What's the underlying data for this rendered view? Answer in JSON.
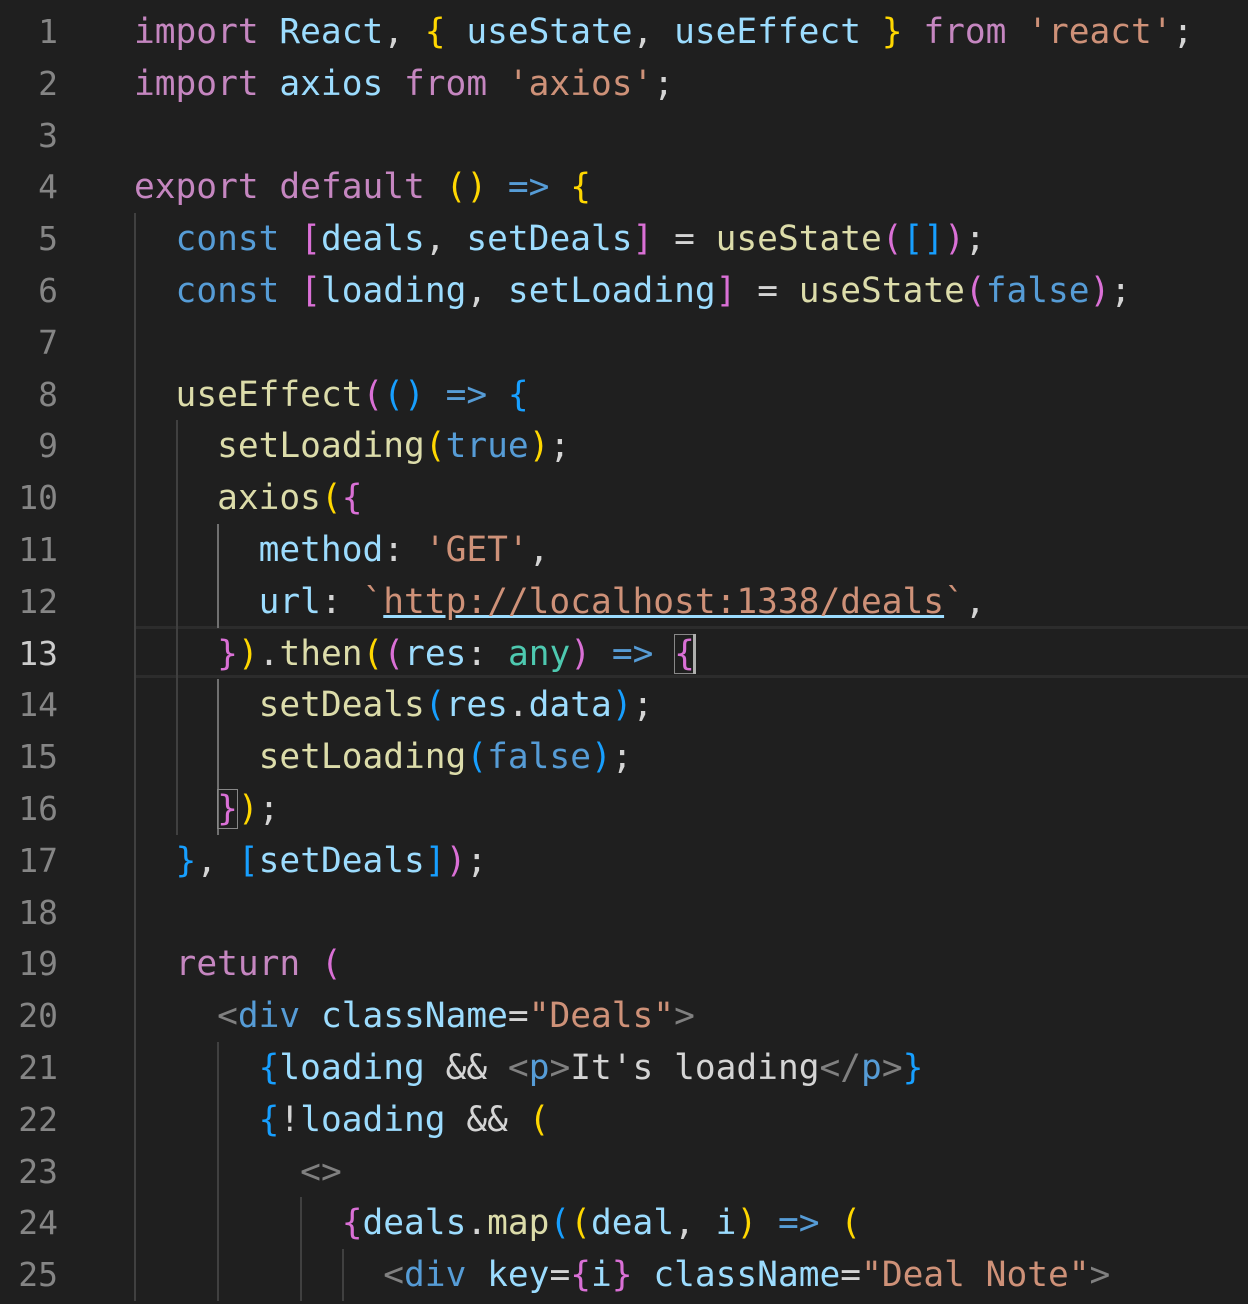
{
  "editor": {
    "active_line": 13,
    "colors": {
      "background": "#1f1f1f",
      "keyword_control": "#c586c0",
      "keyword": "#569cd6",
      "variable": "#9cdcfe",
      "function": "#dcdcaa",
      "string": "#ce9178",
      "type": "#4ec9b0",
      "bracket_level1": "#ffd700",
      "bracket_level2": "#da70d6",
      "bracket_level3": "#179fff"
    },
    "line_numbers": [
      "1",
      "2",
      "3",
      "4",
      "5",
      "6",
      "7",
      "8",
      "9",
      "10",
      "11",
      "12",
      "13",
      "14",
      "15",
      "16",
      "17",
      "18",
      "19",
      "20",
      "21",
      "22",
      "23",
      "24",
      "25"
    ],
    "lines": [
      [
        [
          "kw-import",
          "import"
        ],
        [
          "var",
          " React"
        ],
        [
          "punc",
          ", "
        ],
        [
          "b1",
          "{"
        ],
        [
          "var",
          " useState"
        ],
        [
          "punc",
          ", "
        ],
        [
          "var",
          "useEffect "
        ],
        [
          "b1",
          "}"
        ],
        [
          "kw-import",
          " from"
        ],
        [
          "str",
          " 'react'"
        ],
        [
          "punc",
          ";"
        ]
      ],
      [
        [
          "kw-import",
          "import"
        ],
        [
          "var",
          " axios"
        ],
        [
          "kw-import",
          " from"
        ],
        [
          "str",
          " 'axios'"
        ],
        [
          "punc",
          ";"
        ]
      ],
      [],
      [
        [
          "kw-import",
          "export"
        ],
        [
          "kw-import",
          " default"
        ],
        [
          "punc",
          " "
        ],
        [
          "b1",
          "()"
        ],
        [
          "kw",
          " =>"
        ],
        [
          "punc",
          " "
        ],
        [
          "b1",
          "{"
        ]
      ],
      [
        [
          "punc",
          "  "
        ],
        [
          "kw",
          "const"
        ],
        [
          "punc",
          " "
        ],
        [
          "b2",
          "["
        ],
        [
          "var",
          "deals"
        ],
        [
          "punc",
          ", "
        ],
        [
          "var",
          "setDeals"
        ],
        [
          "b2",
          "]"
        ],
        [
          "punc",
          " = "
        ],
        [
          "fn",
          "useState"
        ],
        [
          "b2",
          "("
        ],
        [
          "b3",
          "[]"
        ],
        [
          "b2",
          ")"
        ],
        [
          "punc",
          ";"
        ]
      ],
      [
        [
          "punc",
          "  "
        ],
        [
          "kw",
          "const"
        ],
        [
          "punc",
          " "
        ],
        [
          "b2",
          "["
        ],
        [
          "var",
          "loading"
        ],
        [
          "punc",
          ", "
        ],
        [
          "var",
          "setLoading"
        ],
        [
          "b2",
          "]"
        ],
        [
          "punc",
          " = "
        ],
        [
          "fn",
          "useState"
        ],
        [
          "b2",
          "("
        ],
        [
          "kw",
          "false"
        ],
        [
          "b2",
          ")"
        ],
        [
          "punc",
          ";"
        ]
      ],
      [],
      [
        [
          "punc",
          "  "
        ],
        [
          "fn",
          "useEffect"
        ],
        [
          "b2",
          "("
        ],
        [
          "b3",
          "()"
        ],
        [
          "kw",
          " =>"
        ],
        [
          "punc",
          " "
        ],
        [
          "b3",
          "{"
        ]
      ],
      [
        [
          "punc",
          "    "
        ],
        [
          "fn",
          "setLoading"
        ],
        [
          "b1",
          "("
        ],
        [
          "kw",
          "true"
        ],
        [
          "b1",
          ")"
        ],
        [
          "punc",
          ";"
        ]
      ],
      [
        [
          "punc",
          "    "
        ],
        [
          "fn",
          "axios"
        ],
        [
          "b1",
          "("
        ],
        [
          "b2",
          "{"
        ]
      ],
      [
        [
          "punc",
          "      "
        ],
        [
          "var",
          "method"
        ],
        [
          "punc",
          ": "
        ],
        [
          "str",
          "'GET'"
        ],
        [
          "punc",
          ","
        ]
      ],
      [
        [
          "punc",
          "      "
        ],
        [
          "var",
          "url"
        ],
        [
          "punc",
          ": "
        ],
        [
          "str",
          "`"
        ],
        [
          "str link",
          "http://localhost:1338/deals"
        ],
        [
          "str",
          "`"
        ],
        [
          "punc",
          ","
        ]
      ],
      [
        [
          "punc",
          "    "
        ],
        [
          "b2",
          "}"
        ],
        [
          "b1",
          ")"
        ],
        [
          "punc",
          "."
        ],
        [
          "fn",
          "then"
        ],
        [
          "b1",
          "("
        ],
        [
          "b2",
          "("
        ],
        [
          "var",
          "res"
        ],
        [
          "punc",
          ": "
        ],
        [
          "type",
          "any"
        ],
        [
          "b2",
          ")"
        ],
        [
          "kw",
          " =>"
        ],
        [
          "punc",
          " "
        ],
        [
          "b2",
          "{"
        ]
      ],
      [
        [
          "punc",
          "      "
        ],
        [
          "fn",
          "setDeals"
        ],
        [
          "b3",
          "("
        ],
        [
          "var",
          "res"
        ],
        [
          "punc",
          "."
        ],
        [
          "var",
          "data"
        ],
        [
          "b3",
          ")"
        ],
        [
          "punc",
          ";"
        ]
      ],
      [
        [
          "punc",
          "      "
        ],
        [
          "fn",
          "setLoading"
        ],
        [
          "b3",
          "("
        ],
        [
          "kw",
          "false"
        ],
        [
          "b3",
          ")"
        ],
        [
          "punc",
          ";"
        ]
      ],
      [
        [
          "punc",
          "    "
        ],
        [
          "b2",
          "}"
        ],
        [
          "b1",
          ")"
        ],
        [
          "punc",
          ";"
        ]
      ],
      [
        [
          "punc",
          "  "
        ],
        [
          "b3",
          "}"
        ],
        [
          "punc",
          ", "
        ],
        [
          "b3",
          "["
        ],
        [
          "var",
          "setDeals"
        ],
        [
          "b3",
          "]"
        ],
        [
          "b2",
          ")"
        ],
        [
          "punc",
          ";"
        ]
      ],
      [],
      [
        [
          "punc",
          "  "
        ],
        [
          "kw-import",
          "return"
        ],
        [
          "punc",
          " "
        ],
        [
          "b2",
          "("
        ]
      ],
      [
        [
          "punc",
          "    "
        ],
        [
          "tag",
          "<"
        ],
        [
          "tagname",
          "div"
        ],
        [
          "attr",
          " className"
        ],
        [
          "punc",
          "="
        ],
        [
          "str",
          "\"Deals\""
        ],
        [
          "tag",
          ">"
        ]
      ],
      [
        [
          "punc",
          "      "
        ],
        [
          "b3",
          "{"
        ],
        [
          "var",
          "loading"
        ],
        [
          "punc",
          " && "
        ],
        [
          "tag",
          "<"
        ],
        [
          "tagname",
          "p"
        ],
        [
          "tag",
          ">"
        ],
        [
          "punc",
          "It's loading"
        ],
        [
          "tag",
          "</"
        ],
        [
          "tagname",
          "p"
        ],
        [
          "tag",
          ">"
        ],
        [
          "b3",
          "}"
        ]
      ],
      [
        [
          "punc",
          "      "
        ],
        [
          "b3",
          "{"
        ],
        [
          "punc",
          "!"
        ],
        [
          "var",
          "loading"
        ],
        [
          "punc",
          " && "
        ],
        [
          "b1",
          "("
        ]
      ],
      [
        [
          "punc",
          "        "
        ],
        [
          "tag",
          "<>"
        ]
      ],
      [
        [
          "punc",
          "          "
        ],
        [
          "b2",
          "{"
        ],
        [
          "var",
          "deals"
        ],
        [
          "punc",
          "."
        ],
        [
          "fn",
          "map"
        ],
        [
          "b3",
          "("
        ],
        [
          "b1",
          "("
        ],
        [
          "var",
          "deal"
        ],
        [
          "punc",
          ", "
        ],
        [
          "var",
          "i"
        ],
        [
          "b1",
          ")"
        ],
        [
          "kw",
          " =>"
        ],
        [
          "punc",
          " "
        ],
        [
          "b1",
          "("
        ]
      ],
      [
        [
          "punc",
          "            "
        ],
        [
          "tag",
          "<"
        ],
        [
          "tagname",
          "div"
        ],
        [
          "attr",
          " key"
        ],
        [
          "punc",
          "="
        ],
        [
          "b2",
          "{"
        ],
        [
          "var",
          "i"
        ],
        [
          "b2",
          "}"
        ],
        [
          "attr",
          " className"
        ],
        [
          "punc",
          "="
        ],
        [
          "str",
          "\"Deal Note\""
        ],
        [
          "tag",
          ">"
        ]
      ]
    ]
  }
}
